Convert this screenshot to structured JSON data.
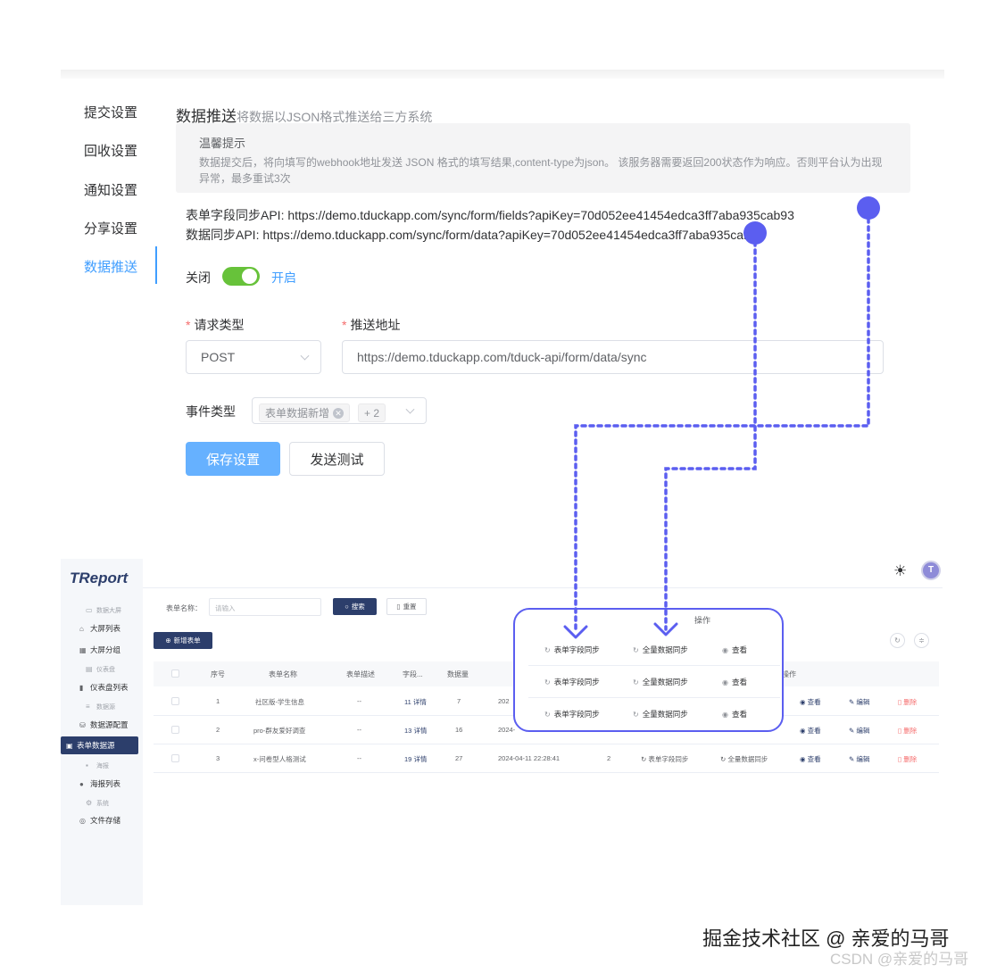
{
  "settings_nav": {
    "items": [
      "提交设置",
      "回收设置",
      "通知设置",
      "分享设置",
      "数据推送"
    ],
    "active": "数据推送"
  },
  "section": {
    "title": "数据推送",
    "subtitle": "将数据以JSON格式推送给三方系统"
  },
  "tip": {
    "title": "温馨提示",
    "text": "数据提交后，将向填写的webhook地址发送 JSON 格式的填写结果,content-type为json。 该服务器需要返回200状态作为响应。否则平台认为出现异常，最多重试3次"
  },
  "api": {
    "fields": "表单字段同步API: https://demo.tduckapp.com/sync/form/fields?apiKey=70d052ee41454edca3ff7aba935cab93",
    "data": "数据同步API: https://demo.tduckapp.com/sync/form/data?apiKey=70d052ee41454edca3ff7aba935cab93"
  },
  "switch": {
    "off_label": "关闭",
    "on_label": "开启",
    "state": "on",
    "color": "#67c23a"
  },
  "request": {
    "type_label": "请求类型",
    "type_value": "POST",
    "url_label": "推送地址",
    "url_value": "https://demo.tduckapp.com/tduck-api/form/data/sync"
  },
  "event": {
    "label": "事件类型",
    "tag": "表单数据新增",
    "more": "+ 2"
  },
  "buttons": {
    "save": "保存设置",
    "test": "发送测试"
  },
  "report": {
    "logo": "TReport",
    "sidebar": {
      "groups": [
        "数据大屏",
        "仪表盘",
        "数据源",
        "海报",
        "系统"
      ],
      "items": {
        "screen_list": "大屏列表",
        "screen_group": "大屏分组",
        "dashboard_list": "仪表盘列表",
        "datasource_config": "数据源配置",
        "form_datasource": "表单数据源",
        "poster_list": "海报列表",
        "file_storage": "文件存储"
      },
      "active": "表单数据源"
    },
    "avatar_letter": "T",
    "search": {
      "label": "表单名称：",
      "placeholder": "请输入",
      "search_btn": "搜索",
      "reset_btn": "重置"
    },
    "new_btn": "新增表单",
    "columns": [
      "序号",
      "表单名称",
      "表单描述",
      "字段...",
      "数据量"
    ],
    "rows": [
      {
        "no": "1",
        "name": "社区版-学生信息",
        "desc": "--",
        "fields": "11",
        "detail": "详情",
        "count": "7",
        "date": "202"
      },
      {
        "no": "2",
        "name": "pro-群友爱好调查",
        "desc": "--",
        "fields": "13",
        "detail": "详情",
        "count": "16",
        "date": "2024-"
      },
      {
        "no": "3",
        "name": "x-问卷型人格测试",
        "desc": "--",
        "fields": "19",
        "detail": "详情",
        "count": "27",
        "date": "2024-04-11 22:28:41"
      }
    ],
    "row3_extra": "2",
    "actions": {
      "header": "操作",
      "field_sync": "表单字段同步",
      "data_sync": "全量数据同步",
      "view": "查看",
      "edit": "编辑",
      "delete": "删除"
    }
  },
  "watermark": {
    "juejin": "掘金技术社区 @ 亲爱的马哥",
    "csdn": "CSDN @亲爱的马哥"
  },
  "colors": {
    "accent": "#409eff",
    "connector": "#5b5ef0",
    "report_primary": "#2c3e6b",
    "danger": "#f56c6c"
  }
}
